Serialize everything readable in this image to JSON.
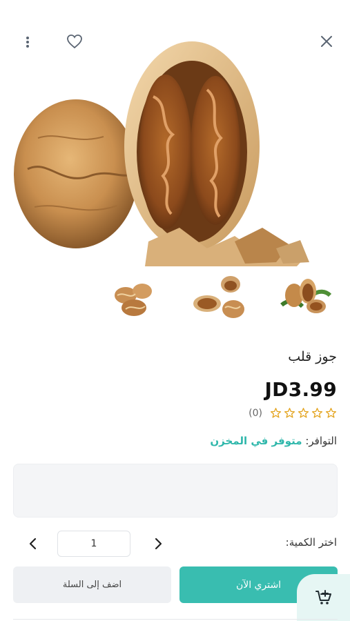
{
  "header": {
    "close_icon": "close-icon",
    "favorite_icon": "heart-icon",
    "menu_icon": "more-vertical-icon"
  },
  "product": {
    "name": "جوز قلب",
    "price": "JD3.99",
    "rating": 0,
    "rating_count": "(0)",
    "availability_label": "التوافر:",
    "availability_value": "متوفر في المخزن",
    "thumbnails": [
      "walnuts-with-leaves",
      "walnuts-shelled-and-halves",
      "walnut-kernels"
    ]
  },
  "quantity": {
    "label": "اختر الكمية:",
    "value": "1"
  },
  "actions": {
    "buy_now": "اشتري الآن",
    "add_to_cart": "اضف إلى السلة"
  },
  "colors": {
    "accent": "#39bdb0",
    "availability": "#2fb7ab",
    "star_outline": "#e3a21a"
  }
}
